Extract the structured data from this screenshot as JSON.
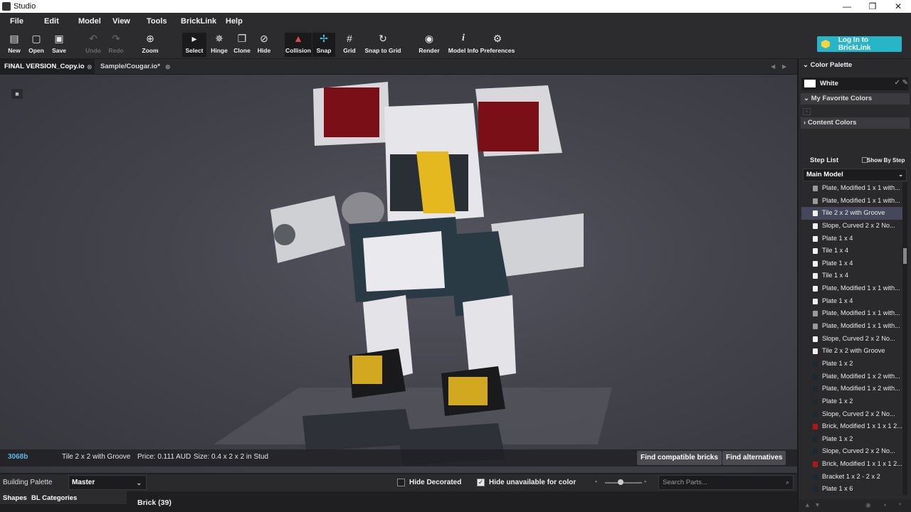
{
  "window": {
    "title": "Studio",
    "controls": [
      "—",
      "❒",
      "✕"
    ]
  },
  "menu": [
    "File",
    "Edit",
    "Model",
    "View",
    "Tools",
    "BrickLink",
    "Help"
  ],
  "toolbar": [
    {
      "label": "New",
      "icon": "new-file-icon",
      "glyph": "▤"
    },
    {
      "label": "Open",
      "icon": "folder-open-icon",
      "glyph": "▢"
    },
    {
      "label": "Save",
      "icon": "save-icon",
      "glyph": "▣"
    },
    {
      "label": "Undo",
      "icon": "undo-icon",
      "glyph": "↶",
      "disabled": true
    },
    {
      "label": "Redo",
      "icon": "redo-icon",
      "glyph": "↷",
      "disabled": true
    },
    {
      "label": "Zoom",
      "icon": "zoom-icon",
      "glyph": "⊕"
    },
    {
      "label": "Select",
      "icon": "select-arrow-icon",
      "glyph": "▸"
    },
    {
      "label": "Hinge",
      "icon": "hinge-icon",
      "glyph": "✵"
    },
    {
      "label": "Clone",
      "icon": "clone-icon",
      "glyph": "❐"
    },
    {
      "label": "Hide",
      "icon": "hide-icon",
      "glyph": "⊘"
    },
    {
      "label": "Collision",
      "icon": "collision-warning-icon",
      "glyph": "▲"
    },
    {
      "label": "Snap",
      "icon": "snap-icon",
      "glyph": "✢"
    },
    {
      "label": "Grid",
      "icon": "grid-icon",
      "glyph": "#"
    },
    {
      "label": "Snap to Grid",
      "icon": "snap-to-grid-icon",
      "glyph": "↻"
    },
    {
      "label": "Render",
      "icon": "camera-icon",
      "glyph": "◉"
    },
    {
      "label": "Model Info",
      "icon": "info-icon",
      "glyph": "i"
    },
    {
      "label": "Preferences",
      "icon": "gear-icon",
      "glyph": "⚙"
    }
  ],
  "login_button": "Log In to BrickLink",
  "tabs": [
    {
      "label": "FINAL VERSION_Copy.io",
      "active": true
    },
    {
      "label": "Sample/Cougar.io*",
      "active": false
    }
  ],
  "status": {
    "part_id": "3068b",
    "part_name": "Tile 2 x 2 with Groove",
    "price": "Price: 0.111 AUD",
    "size": "Size: 0.4 x 2 x 2 in Stud",
    "find_compatible": "Find compatible bricks",
    "find_alternatives": "Find alternatives"
  },
  "bottom": {
    "building_palette": "Building Palette",
    "palette_select": "Master",
    "hide_decorated": "Hide Decorated",
    "hide_decorated_checked": false,
    "hide_unavailable": "Hide unavailable for color",
    "hide_unavailable_checked": true,
    "search_placeholder": "Search Parts...",
    "shapes_tab": "Shapes",
    "bl_categories_tab": "BL Categories",
    "brick_category": "Brick (39)"
  },
  "right_panel": {
    "color_palette": "Color Palette",
    "current_color": "White",
    "favorite_colors": "My Favorite Colors",
    "content_colors": "Content Colors",
    "step_list": "Step List",
    "show_by_step": "Show By Step",
    "model_select": "Main Model",
    "steps": [
      {
        "label": "Plate, Modified 1 x 1 with...",
        "color": "#9a9a9a"
      },
      {
        "label": "Plate, Modified 1 x 1 with...",
        "color": "#9a9a9a"
      },
      {
        "label": "Tile 2 x 2 with Groove",
        "color": "#f2f2f2",
        "selected": true
      },
      {
        "label": "Slope, Curved 2 x 2 No...",
        "color": "#f2f2f2"
      },
      {
        "label": "Plate 1 x 4",
        "color": "#f2f2f2"
      },
      {
        "label": "Tile 1 x 4",
        "color": "#f2f2f2"
      },
      {
        "label": "Plate 1 x 4",
        "color": "#f2f2f2"
      },
      {
        "label": "Tile 1 x 4",
        "color": "#f2f2f2"
      },
      {
        "label": "Plate, Modified 1 x 1 with...",
        "color": "#f2f2f2"
      },
      {
        "label": "Plate 1 x 4",
        "color": "#f2f2f2"
      },
      {
        "label": "Plate, Modified 1 x 1 with...",
        "color": "#9a9a9a"
      },
      {
        "label": "Plate, Modified 1 x 1 with...",
        "color": "#9a9a9a"
      },
      {
        "label": "Slope, Curved 2 x 2 No...",
        "color": "#f2f2f2"
      },
      {
        "label": "Tile 2 x 2 with Groove",
        "color": "#f2f2f2"
      },
      {
        "label": "Plate 1 x 2",
        "color": "#1a2a30"
      },
      {
        "label": "Plate, Modified 1 x 2 with...",
        "color": "#1a2a30"
      },
      {
        "label": "Plate, Modified 1 x 2 with...",
        "color": "#1a2a30"
      },
      {
        "label": "Plate 1 x 2",
        "color": "#1a2a30"
      },
      {
        "label": "Slope, Curved 2 x 2 No...",
        "color": "#1a2a30"
      },
      {
        "label": "Brick, Modified 1 x 1 x 1 2...",
        "color": "#b01818"
      },
      {
        "label": "Plate 1 x 2",
        "color": "#1a2a30"
      },
      {
        "label": "Slope, Curved 2 x 2 No...",
        "color": "#1a2a30"
      },
      {
        "label": "Brick, Modified 1 x 1 x 1 2...",
        "color": "#b01818"
      },
      {
        "label": "Bracket 1 x 2 - 2 x 2",
        "color": "#1a2a30"
      },
      {
        "label": "Plate 1 x 6",
        "color": "#1a2a30"
      }
    ]
  },
  "colors": {
    "accent": "#27b6c8",
    "part_id": "#5fb6e8",
    "selected_row": "#44485a"
  }
}
